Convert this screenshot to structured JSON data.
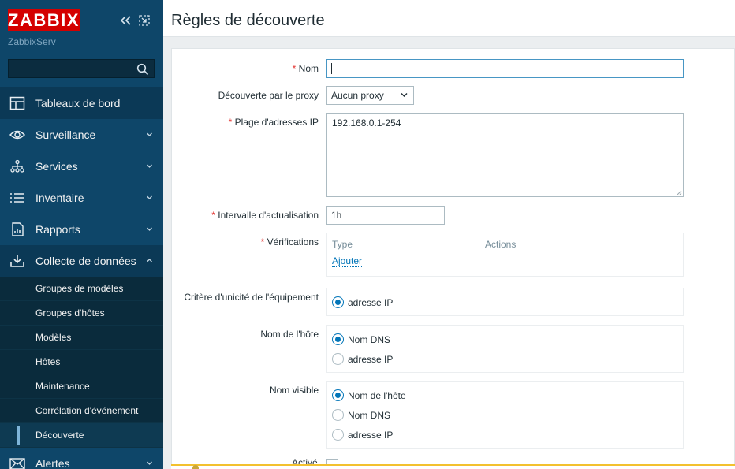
{
  "sidebar": {
    "logo": "ZABBIX",
    "server_name": "ZabbixServ",
    "search": {
      "value": "",
      "placeholder": ""
    },
    "items": [
      {
        "label": "Tableaux de bord",
        "icon": "dashboard-icon"
      },
      {
        "label": "Surveillance",
        "icon": "eye-icon"
      },
      {
        "label": "Services",
        "icon": "services-icon"
      },
      {
        "label": "Inventaire",
        "icon": "list-icon"
      },
      {
        "label": "Rapports",
        "icon": "report-icon"
      },
      {
        "label": "Collecte de données",
        "icon": "download-icon"
      }
    ],
    "submenu": [
      {
        "label": "Groupes de modèles"
      },
      {
        "label": "Groupes d'hôtes"
      },
      {
        "label": "Modèles"
      },
      {
        "label": "Hôtes"
      },
      {
        "label": "Maintenance"
      },
      {
        "label": "Corrélation d'événement"
      },
      {
        "label": "Découverte"
      }
    ],
    "last_item": {
      "label": "Alertes",
      "icon": "mail-icon"
    }
  },
  "header": {
    "title": "Règles de découverte"
  },
  "form": {
    "name": {
      "label": "Nom",
      "value": ""
    },
    "proxy": {
      "label": "Découverte par le proxy",
      "value": "Aucun proxy"
    },
    "ip_range": {
      "label": "Plage d'adresses IP",
      "value": "192.168.0.1-254"
    },
    "interval": {
      "label": "Intervalle d'actualisation",
      "value": "1h"
    },
    "checks": {
      "label": "Vérifications",
      "col_type": "Type",
      "col_actions": "Actions",
      "add_link": "Ajouter"
    },
    "uniqueness": {
      "label": "Critère d'unicité de l'équipement",
      "options": [
        "adresse IP"
      ],
      "selected": 0
    },
    "host_name": {
      "label": "Nom de l'hôte",
      "options": [
        "Nom DNS",
        "adresse IP"
      ],
      "selected": 0
    },
    "visible_name": {
      "label": "Nom visible",
      "options": [
        "Nom de l'hôte",
        "Nom DNS",
        "adresse IP"
      ],
      "selected": 0
    },
    "enabled": {
      "label": "Activé"
    }
  },
  "colors": {
    "sidebar": "#0e4669",
    "accent": "#0275b8",
    "logo_bg": "#d40000",
    "required": "#e33734"
  }
}
